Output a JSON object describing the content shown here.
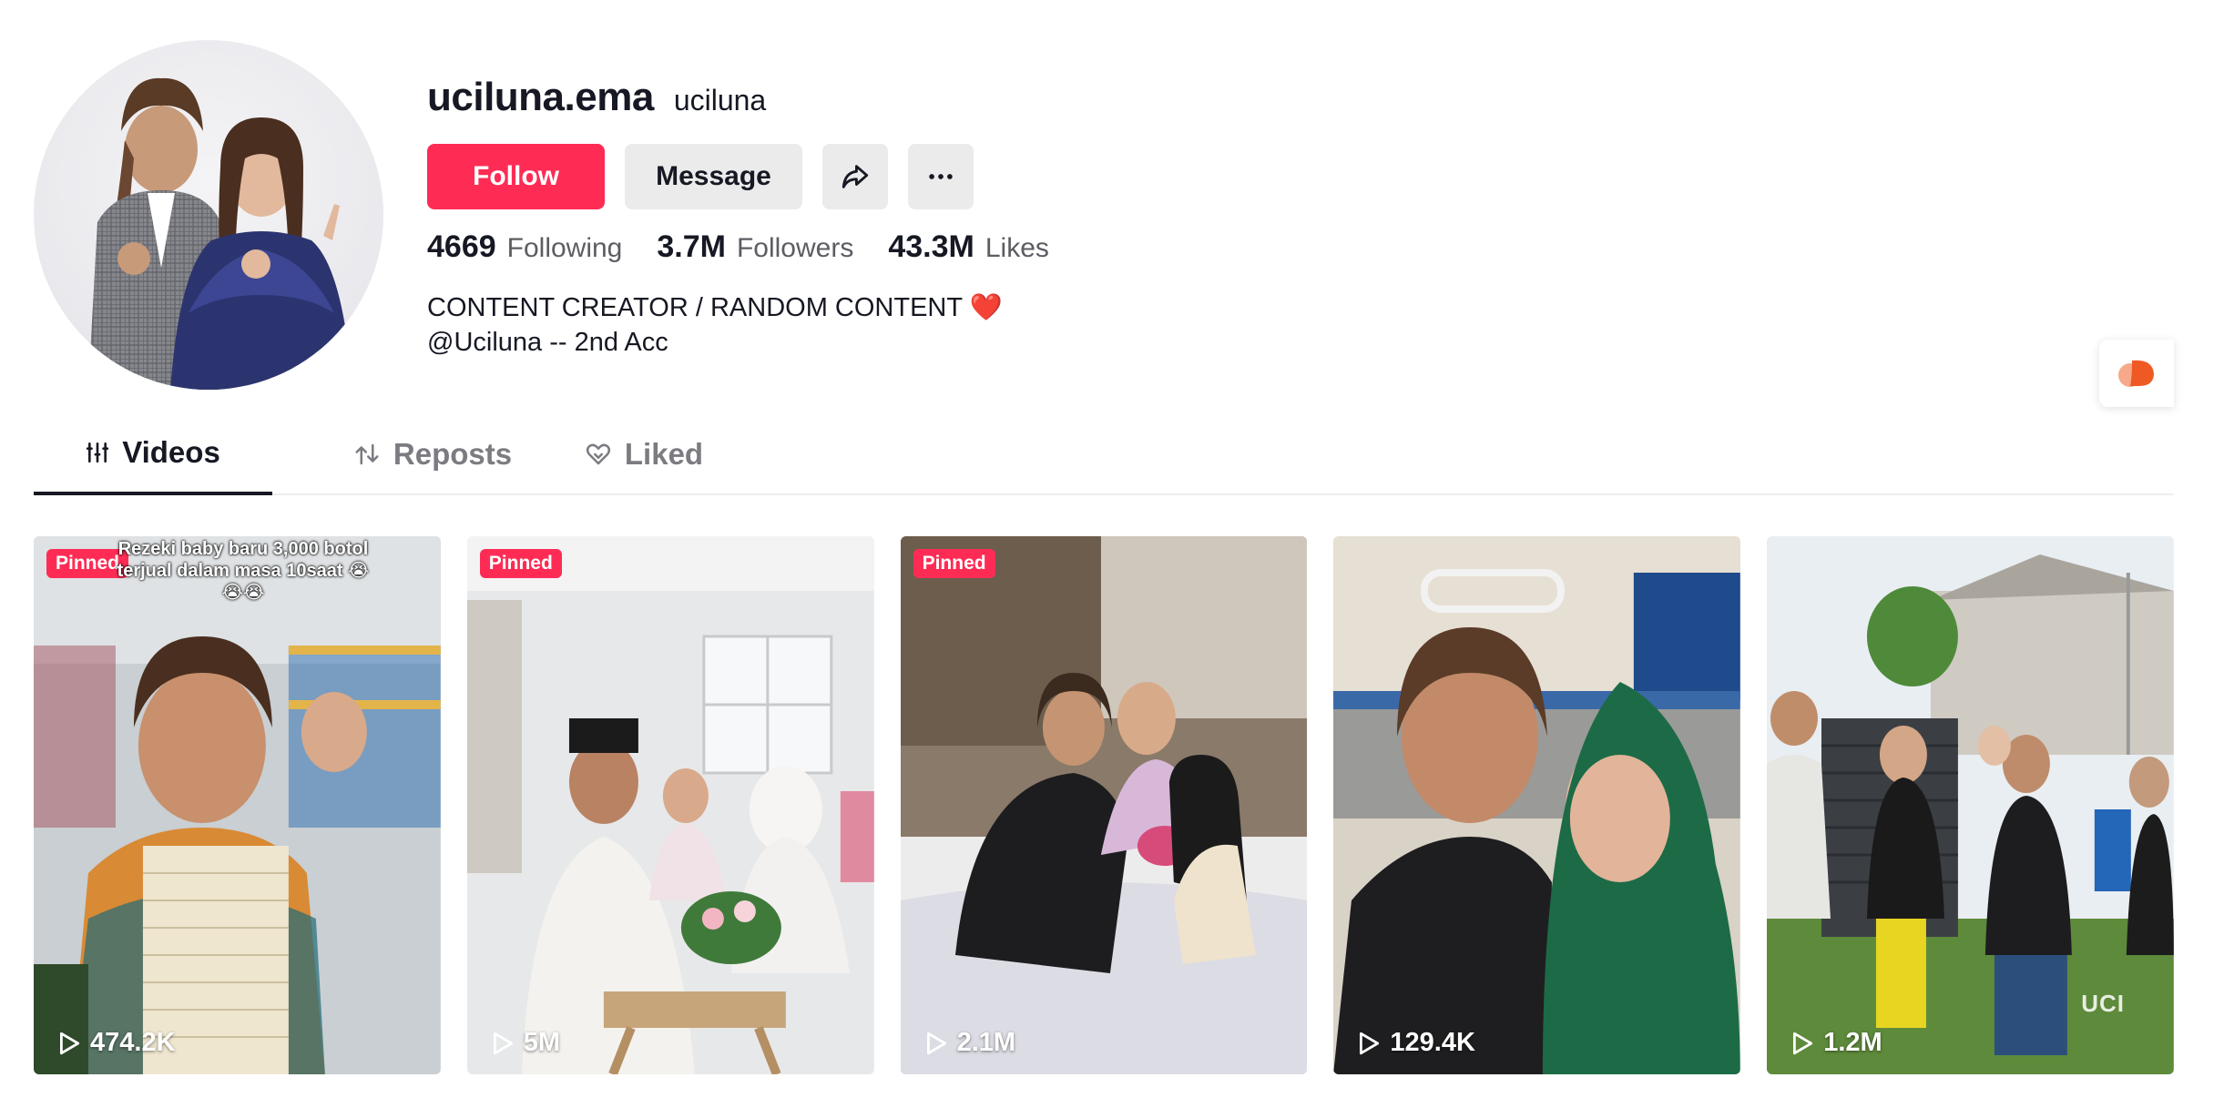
{
  "profile": {
    "unique_id": "uciluna.ema",
    "nickname": "uciluna",
    "follow_label": "Follow",
    "message_label": "Message",
    "stats": [
      {
        "number": "4669",
        "label": "Following"
      },
      {
        "number": "3.7M",
        "label": "Followers"
      },
      {
        "number": "43.3M",
        "label": "Likes"
      }
    ],
    "bio_line1": "CONTENT CREATOR / RANDOM CONTENT ❤️",
    "bio_line2": "@Uciluna -- 2nd Acc"
  },
  "tabs": [
    {
      "label": "Videos",
      "icon": "grid-icon",
      "active": true
    },
    {
      "label": "Reposts",
      "icon": "repost-icon",
      "active": false
    },
    {
      "label": "Liked",
      "icon": "liked-heart-icon",
      "active": false
    }
  ],
  "videos": [
    {
      "pinned": "Pinned",
      "caption": "Rezeki baby baru 3,000 botol terjual dalam masa 10saat 😭😭😭",
      "views": "474.2K"
    },
    {
      "pinned": "Pinned",
      "views": "5M"
    },
    {
      "pinned": "Pinned",
      "views": "2.1M"
    },
    {
      "views": "129.4K"
    },
    {
      "views": "1.2M",
      "watermark": "UCI"
    }
  ],
  "colors": {
    "accent": "#fe2c55",
    "text": "#161823",
    "secondary_text": "#5c5c63",
    "button_gray": "#ebebeb"
  }
}
